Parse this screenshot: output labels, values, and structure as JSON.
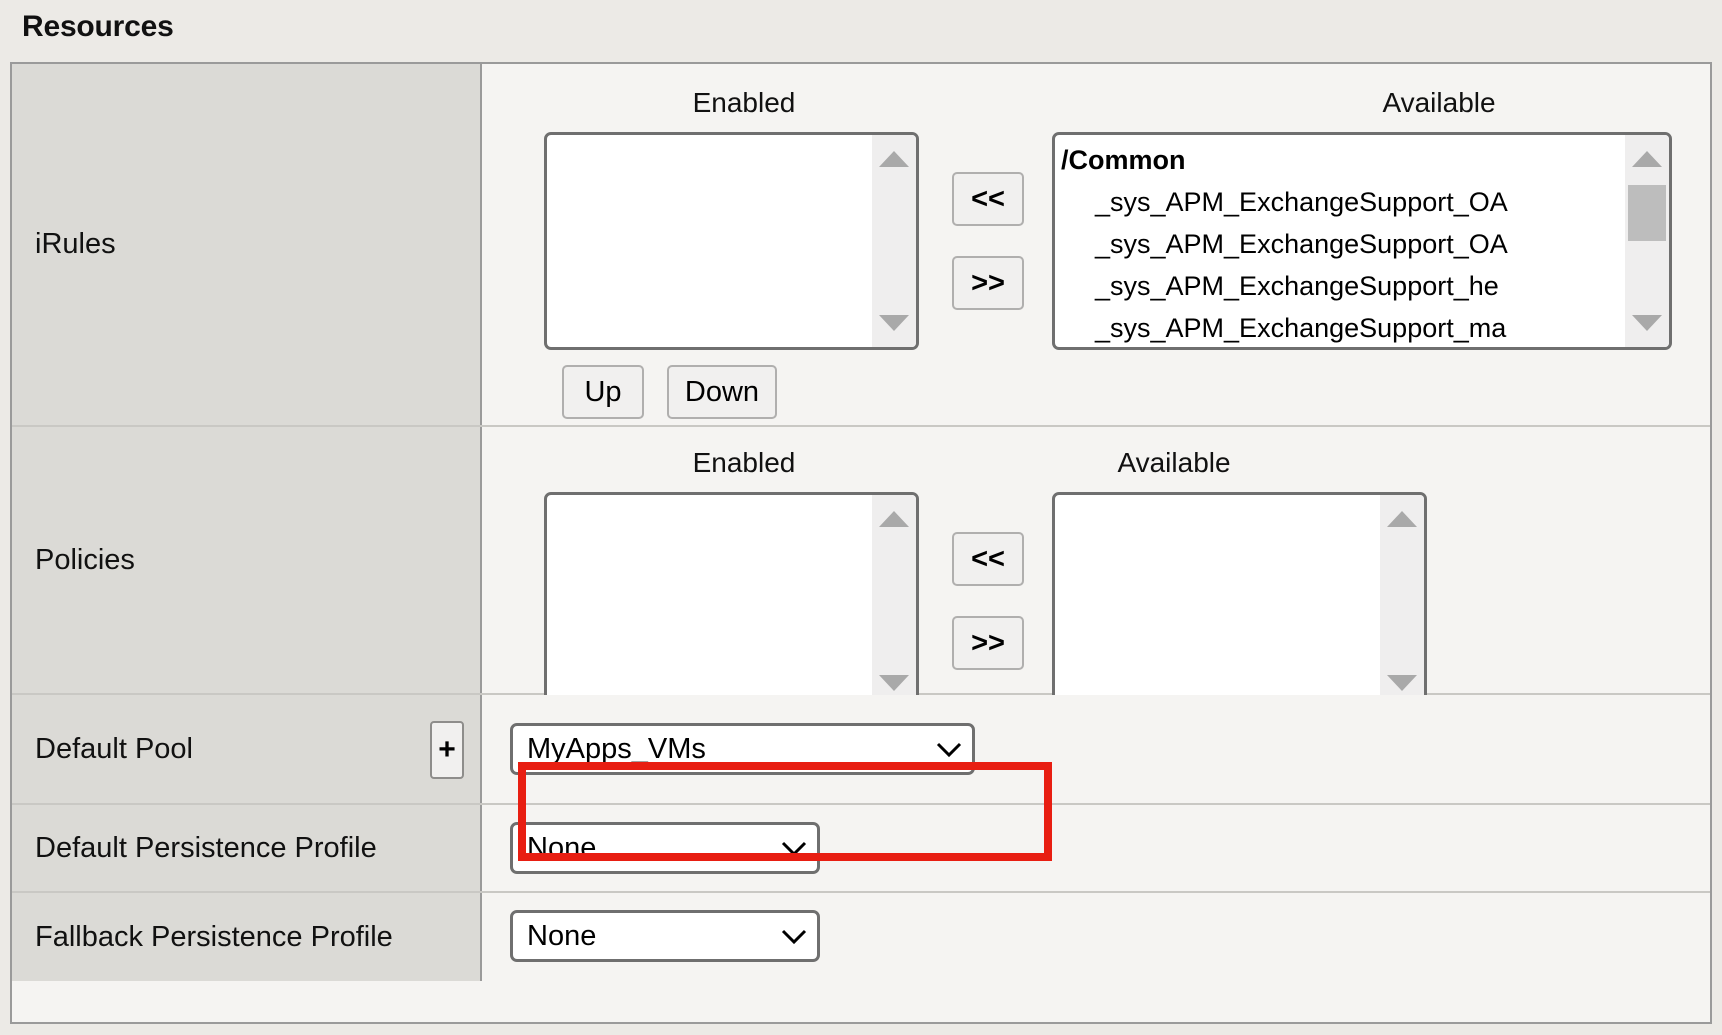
{
  "page": {
    "section_title": "Resources",
    "accent_highlight_color": "#e81e12",
    "label_column_bg": "#dbdad6",
    "content_bg": "#f5f4f2"
  },
  "columns": {
    "enabled_header": "Enabled",
    "available_header": "Available"
  },
  "transfer_buttons": {
    "move_left_label": "<<",
    "move_right_label": ">>"
  },
  "order_buttons": {
    "up_label": "Up",
    "down_label": "Down"
  },
  "rows": {
    "irules": {
      "label": "iRules",
      "enabled_items": [],
      "available_items": [
        {
          "text": "/Common",
          "type": "root"
        },
        {
          "text": "_sys_APM_ExchangeSupport_OA",
          "type": "child"
        },
        {
          "text": "_sys_APM_ExchangeSupport_OA",
          "type": "child"
        },
        {
          "text": "_sys_APM_ExchangeSupport_he",
          "type": "child"
        },
        {
          "text": "_sys_APM_ExchangeSupport_ma",
          "type": "child"
        }
      ]
    },
    "policies": {
      "label": "Policies",
      "enabled_items": [],
      "available_items": []
    },
    "default_pool": {
      "label": "Default Pool",
      "add_button_label": "+",
      "selected_value": "MyApps_VMs",
      "highlighted": true
    },
    "default_persistence_profile": {
      "label": "Default Persistence Profile",
      "selected_value": "None"
    },
    "fallback_persistence_profile": {
      "label": "Fallback Persistence Profile",
      "selected_value": "None"
    }
  },
  "icons": {
    "chevron_down": "chevron-down-icon",
    "scroll_up": "scroll-up-arrow-icon",
    "scroll_down": "scroll-down-arrow-icon",
    "scroll_thumb": "scrollbar-thumb"
  }
}
